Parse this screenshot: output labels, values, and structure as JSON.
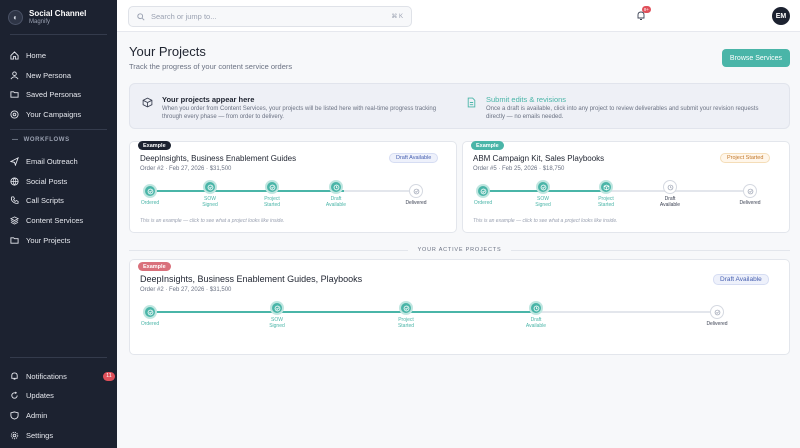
{
  "brand": {
    "name": "Social Channel",
    "sub": "Magnify",
    "logo_icon": "brand-logo-icon"
  },
  "sidebar": {
    "items": [
      {
        "label": "Home",
        "icon": "home-icon"
      },
      {
        "label": "New Persona",
        "icon": "user-icon"
      },
      {
        "label": "Saved Personas",
        "icon": "folder-icon"
      },
      {
        "label": "Your Campaigns",
        "icon": "target-icon"
      }
    ],
    "section_label": "WORKFLOWS",
    "workflow_items": [
      {
        "label": "Email Outreach",
        "icon": "send-icon"
      },
      {
        "label": "Social Posts",
        "icon": "globe-icon"
      },
      {
        "label": "Call Scripts",
        "icon": "phone-icon"
      },
      {
        "label": "Content Services",
        "icon": "layers-icon"
      },
      {
        "label": "Your Projects",
        "icon": "folder-icon"
      }
    ],
    "bottom_items": [
      {
        "label": "Notifications",
        "icon": "bell-icon",
        "badge": "11"
      },
      {
        "label": "Updates",
        "icon": "refresh-icon"
      },
      {
        "label": "Admin",
        "icon": "shield-icon"
      },
      {
        "label": "Settings",
        "icon": "gear-icon"
      }
    ]
  },
  "topbar": {
    "search_placeholder": "Search or jump to...",
    "search_shortcut": "⌘ K",
    "bell_badge": "9+",
    "avatar_initials": "EM"
  },
  "page": {
    "title": "Your Projects",
    "subtitle": "Track the progress of your content service orders",
    "browse_button": "Browse Services"
  },
  "info": {
    "left_title": "Your projects appear here",
    "left_desc": "When you order from Content Services, your projects will be listed here with real-time progress tracking through every phase — from order to delivery.",
    "right_title": "Submit edits & revisions",
    "right_desc": "Once a draft is available, click into any project to review deliverables and submit your revision requests directly — no emails needed."
  },
  "colors": {
    "accent": "#4ab5a8",
    "sidebar": "#1c2230",
    "example_dark": "#1c2230",
    "example_teal": "#4ab5a8",
    "example_red": "#d9707b"
  },
  "examples": [
    {
      "pill": "Example",
      "title": "DeepInsights, Business Enablement Guides",
      "meta": "Order #2 · Feb 27, 2026 · $31,500",
      "status": "Draft Available",
      "footnote": "This is an example — click to see what a project looks like inside.",
      "steps": [
        {
          "label": "Ordered",
          "done": true
        },
        {
          "label": "SOW Signed",
          "done": true
        },
        {
          "label": "Project Started",
          "done": true
        },
        {
          "label": "Draft Available",
          "done": true
        },
        {
          "label": "Delivered",
          "done": false
        }
      ]
    },
    {
      "pill": "Example",
      "title": "ABM Campaign Kit, Sales Playbooks",
      "meta": "Order #5 · Feb 25, 2026 · $18,750",
      "status": "Project Started",
      "footnote": "This is an example — click to see what a project looks like inside.",
      "steps": [
        {
          "label": "Ordered",
          "done": true
        },
        {
          "label": "SOW Signed",
          "done": true
        },
        {
          "label": "Project Started",
          "done": true
        },
        {
          "label": "Draft Available",
          "done": false
        },
        {
          "label": "Delivered",
          "done": false
        }
      ]
    }
  ],
  "active_label": "YOUR ACTIVE PROJECTS",
  "active": {
    "pill": "Example",
    "title": "DeepInsights, Business Enablement Guides, Playbooks",
    "meta": "Order #2 · Feb 27, 2026 · $31,500",
    "status": "Draft Available",
    "steps": [
      {
        "label": "Ordered",
        "done": true
      },
      {
        "label": "SOW Signed",
        "done": true
      },
      {
        "label": "Project Started",
        "done": true
      },
      {
        "label": "Draft Available",
        "done": true
      },
      {
        "label": "Delivered",
        "done": false
      }
    ]
  }
}
